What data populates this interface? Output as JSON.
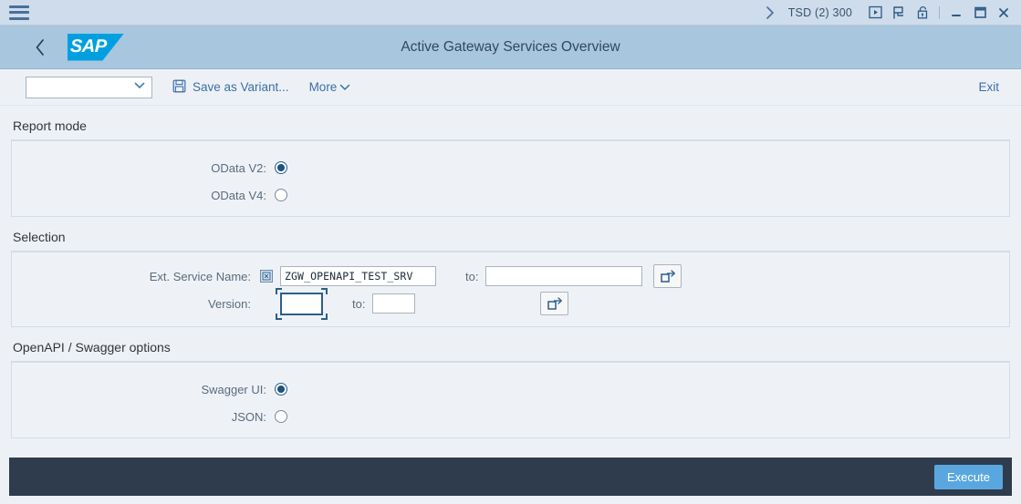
{
  "window": {
    "menu_icon": "hamburger-icon",
    "expand_icon": "chevron-right-icon",
    "system_info": "TSD (2) 300",
    "icons": [
      "play-box-icon",
      "flag-p-icon",
      "unlock-icon"
    ],
    "controls": [
      "minimize-icon",
      "maximize-icon",
      "close-icon"
    ]
  },
  "shell": {
    "back_icon": "chevron-left-icon",
    "logo_text": "SAP",
    "title": "Active Gateway Services Overview"
  },
  "toolbar": {
    "variant_value": "",
    "variant_placeholder": "",
    "dropdown_icon": "chevron-down-icon",
    "save_icon": "save-floppy-icon",
    "save_label": "Save as Variant...",
    "more_label": "More",
    "more_icon": "chevron-down-icon",
    "exit_label": "Exit"
  },
  "report_mode": {
    "group_title": "Report mode",
    "options": [
      {
        "label": "OData V2:",
        "selected": true
      },
      {
        "label": "OData V4:",
        "selected": false
      }
    ]
  },
  "selection": {
    "group_title": "Selection",
    "rows": [
      {
        "label": "Ext. Service Name:",
        "multi_icon": "multiple-selection-icon",
        "value": "ZGW_OPENAPI_TEST_SRV",
        "to_label": "to:",
        "to_value": "",
        "range_icon": "multi-select-arrow-icon"
      },
      {
        "label": "Version:",
        "value": "",
        "to_label": "to:",
        "to_value": "",
        "range_icon": "multi-select-arrow-icon"
      }
    ]
  },
  "swagger_options": {
    "group_title": "OpenAPI / Swagger options",
    "options": [
      {
        "label": "Swagger UI:",
        "selected": true
      },
      {
        "label": "JSON:",
        "selected": false
      }
    ]
  },
  "footer": {
    "execute_label": "Execute"
  },
  "colors": {
    "shell_bar": "#a8c6de",
    "window_bar": "#cfdceb",
    "page_bg": "#edf1f6",
    "panel_bg": "#eef2f7",
    "footer_bg": "#2f3c4d",
    "accent_button": "#5aa7e0",
    "link": "#3b6ea5",
    "sap_logo": "#00a0e0"
  }
}
